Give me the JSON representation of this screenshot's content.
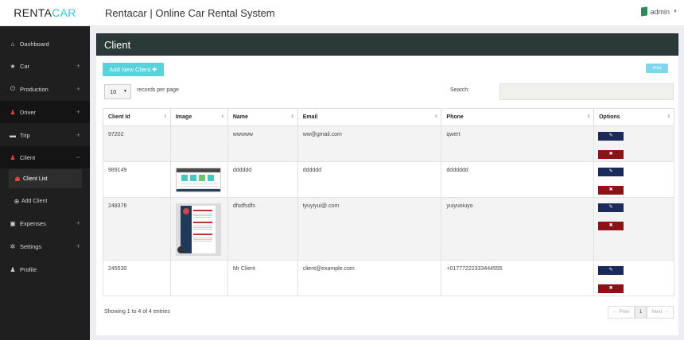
{
  "brand": {
    "part1": "RENTA",
    "part2": "CAR"
  },
  "app_title": "Rentacar | Online Car Rental System",
  "user": {
    "name": "admin"
  },
  "sidebar": {
    "items": [
      {
        "label": "Dashboard",
        "icon": "home-icon",
        "glyph": "⌂",
        "plus": ""
      },
      {
        "label": "Car",
        "icon": "star-icon",
        "glyph": "★",
        "plus": "+"
      },
      {
        "label": "Production",
        "icon": "power-icon",
        "glyph": "⏻",
        "plus": "+"
      },
      {
        "label": "Driver",
        "icon": "user-icon",
        "glyph": "♟",
        "plus": "+"
      },
      {
        "label": "Trip",
        "icon": "truck-icon",
        "glyph": "▬",
        "plus": "+"
      },
      {
        "label": "Client",
        "icon": "user-icon",
        "glyph": "♟",
        "plus": "−"
      },
      {
        "label": "Client List",
        "icon": "users-icon",
        "glyph": "☗"
      },
      {
        "label": "Add Client",
        "icon": "plus-circle-icon",
        "glyph": "⊕"
      },
      {
        "label": "Expenses",
        "icon": "money-icon",
        "glyph": "▣",
        "plus": "+"
      },
      {
        "label": "Settings",
        "icon": "gears-icon",
        "glyph": "✲",
        "plus": "+"
      },
      {
        "label": "Profile",
        "icon": "user-icon",
        "glyph": "♟",
        "plus": ""
      }
    ]
  },
  "page": {
    "title": "Client"
  },
  "toolbar": {
    "add_label": "Add New Client ✚",
    "print_label": "Print"
  },
  "length": {
    "value": "10",
    "label": "records per page"
  },
  "search": {
    "label": "Search:",
    "value": ""
  },
  "table": {
    "columns": [
      "Client Id",
      "Image",
      "Name",
      "Email",
      "Phone",
      "Options"
    ],
    "rows": [
      {
        "id": "97202",
        "image": "",
        "name": "wwwww",
        "email": "ww@gmail.com",
        "phone": "qwert"
      },
      {
        "id": "989149",
        "image": "screenshot",
        "name": "dddddd",
        "email": "dddddd",
        "phone": "ddddddd"
      },
      {
        "id": "248376",
        "image": "resume",
        "name": "dfsdfsdfs",
        "email": "tyuyiyui@.com",
        "phone": "yuiyuoiuyo"
      },
      {
        "id": "245530",
        "image": "",
        "name": "Mr Client",
        "email": "client@example.com",
        "phone": "+01777222333444555"
      }
    ],
    "edit_glyph": "✎",
    "delete_glyph": "✖"
  },
  "footer": {
    "info": "Showing 1 to 4 of 4 entries",
    "prev": "← Prev",
    "page": "1",
    "next": "Next →"
  },
  "colors": {
    "accent": "#56d3dd",
    "header": "#2b3a36",
    "edit": "#1b2a5a",
    "delete": "#8a1317",
    "sidebar": "#1f1f1f"
  }
}
